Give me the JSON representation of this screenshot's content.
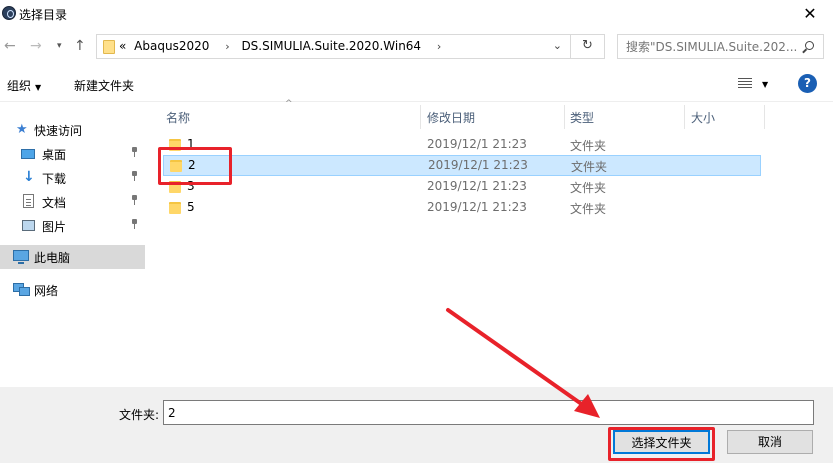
{
  "window": {
    "title": "选择目录",
    "close": "✕"
  },
  "address": {
    "prefix": "«",
    "crumbs": [
      "Abaqus2020",
      "DS.SIMULIA.Suite.2020.Win64"
    ],
    "sep": "›",
    "search_placeholder": "搜索\"DS.SIMULIA.Suite.202..."
  },
  "toolbar": {
    "organize": "组织",
    "new_folder": "新建文件夹"
  },
  "sidebar": {
    "quick_access": "快速访问",
    "desktop": "桌面",
    "downloads": "下载",
    "documents": "文档",
    "pictures": "图片",
    "this_pc": "此电脑",
    "network": "网络"
  },
  "columns": {
    "name": "名称",
    "modified": "修改日期",
    "type": "类型",
    "size": "大小"
  },
  "files": [
    {
      "name": "1",
      "modified": "2019/12/1 21:23",
      "type": "文件夹"
    },
    {
      "name": "2",
      "modified": "2019/12/1 21:23",
      "type": "文件夹"
    },
    {
      "name": "3",
      "modified": "2019/12/1 21:23",
      "type": "文件夹"
    },
    {
      "name": "5",
      "modified": "2019/12/1 21:23",
      "type": "文件夹"
    }
  ],
  "footer": {
    "folder_label": "文件夹:",
    "folder_value": "2",
    "select_button": "选择文件夹",
    "cancel_button": "取消"
  },
  "colors": {
    "annotation": "#e8222a",
    "selection": "#cce8ff"
  }
}
